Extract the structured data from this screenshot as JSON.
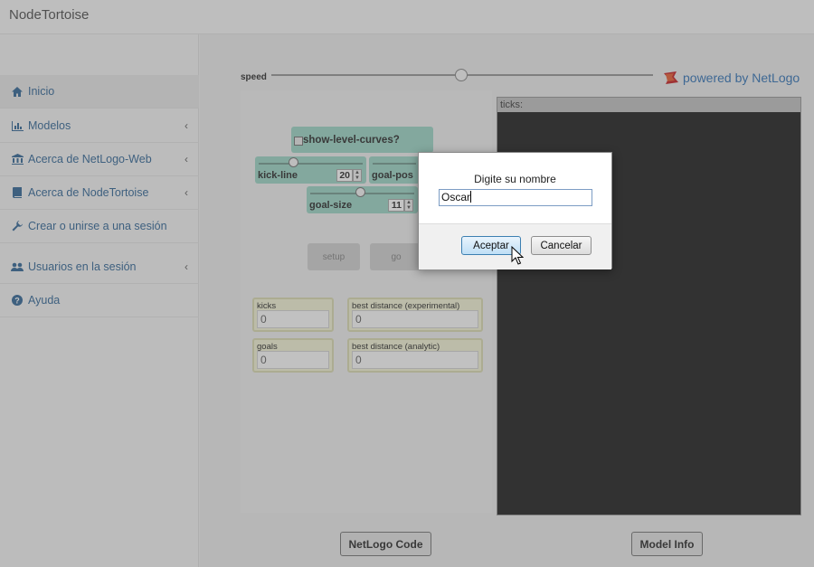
{
  "app": {
    "title": "NodeTortoise"
  },
  "sidebar": {
    "items": [
      {
        "label": "Inicio",
        "icon": "home-icon",
        "chevron": false
      },
      {
        "label": "Modelos",
        "icon": "bar-chart-icon",
        "chevron": true
      },
      {
        "label": "Acerca de NetLogo-Web",
        "icon": "institution-icon",
        "chevron": true
      },
      {
        "label": "Acerca de NodeTortoise",
        "icon": "book-icon",
        "chevron": true
      },
      {
        "label": "Crear o unirse a una sesión",
        "icon": "wrench-icon",
        "chevron": false
      },
      {
        "label": "Usuarios en la sesión",
        "icon": "users-icon",
        "chevron": true
      },
      {
        "label": "Ayuda",
        "icon": "question-circle-icon",
        "chevron": false
      }
    ]
  },
  "toolbar": {
    "speed_label": "speed",
    "powered_by": "powered by NetLogo"
  },
  "widgets": {
    "switch_label": "show-level-curves?",
    "kick_line": {
      "label": "kick-line",
      "value": "20"
    },
    "goal_pos": {
      "label": "goal-pos"
    },
    "goal_size": {
      "label": "goal-size",
      "value": "11"
    },
    "setup_label": "setup",
    "go_label": "go"
  },
  "monitors": {
    "kicks": {
      "label": "kicks",
      "value": "0"
    },
    "best_exp": {
      "label": "best distance (experimental)",
      "value": "0"
    },
    "goals": {
      "label": "goals",
      "value": "0"
    },
    "best_analytic": {
      "label": "best distance (analytic)",
      "value": "0"
    }
  },
  "view": {
    "ticks_label": "ticks:"
  },
  "footer": {
    "code_label": "NetLogo Code",
    "info_label": "Model Info"
  },
  "dialog": {
    "prompt": "Digite su nombre",
    "input_value": "Oscar",
    "ok_label": "Aceptar",
    "cancel_label": "Cancelar"
  },
  "colors": {
    "link": "#3a6c9a",
    "switch_green": "#9fd6c8",
    "monitor_yellow": "#f3f3d7",
    "view_bg": "#282828"
  }
}
